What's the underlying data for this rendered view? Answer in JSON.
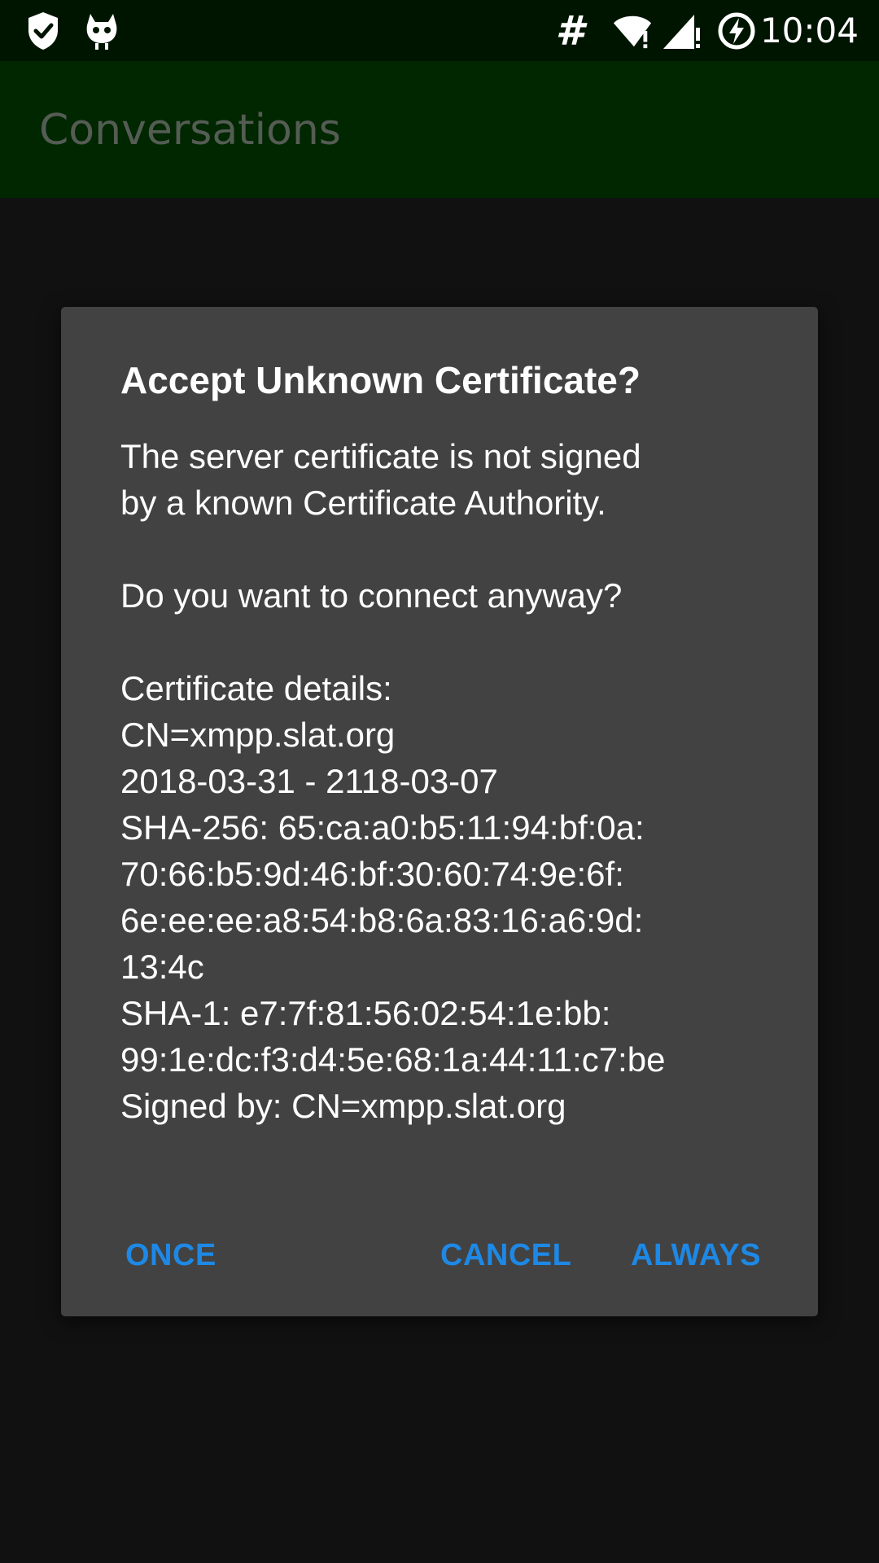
{
  "status_bar": {
    "time": "10:04",
    "icons": [
      "shield-check-icon",
      "cyanogen-mascot-icon",
      "hash-icon",
      "wifi-alert-icon",
      "signal-alert-icon",
      "battery-charging-icon"
    ],
    "hash_glyph": "#"
  },
  "app_bar": {
    "title": "Conversations"
  },
  "dialog": {
    "title": "Accept Unknown Certificate?",
    "message_lines": [
      "The server certificate is not signed",
      "by a known Certificate Authority.",
      "",
      "Do you want to connect anyway?",
      "",
      "Certificate details:",
      "CN=xmpp.slat.org",
      "2018-03-31 - 2118-03-07",
      "SHA-256: 65:ca:a0:b5:11:94:bf:0a:",
      "70:66:b5:9d:46:bf:30:60:74:9e:6f:",
      "6e:ee:ee:a8:54:b8:6a:83:16:a6:9d:",
      "13:4c",
      "SHA-1: e7:7f:81:56:02:54:1e:bb:",
      "99:1e:dc:f3:d4:5e:68:1a:44:11:c7:be",
      "Signed by: CN=xmpp.slat.org"
    ],
    "buttons": {
      "once": "ONCE",
      "cancel": "CANCEL",
      "always": "ALWAYS"
    }
  },
  "colors": {
    "status_bar_bg": "#001500",
    "app_bar_bg": "#002700",
    "dialog_bg": "#424242",
    "button_accent": "#1e88e5",
    "background": "#111111"
  }
}
